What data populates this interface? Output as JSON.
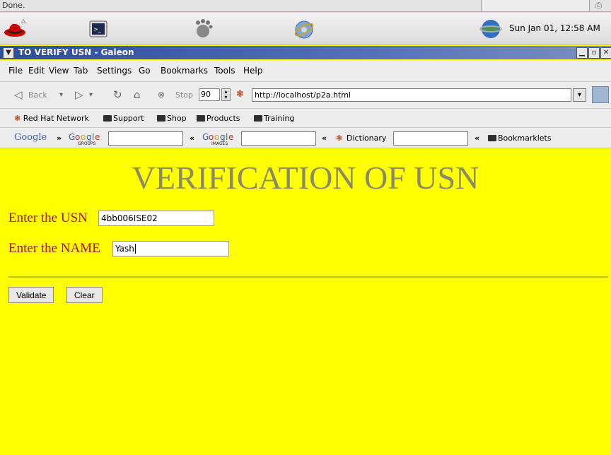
{
  "status": {
    "text": "Done."
  },
  "panel": {
    "clock": "Sun Jan 01, 12:58 AM"
  },
  "window": {
    "title": "TO VERIFY USN - Galeon"
  },
  "menubar": [
    "File",
    "Edit",
    "View",
    "Tab",
    "Settings",
    "Go",
    "Bookmarks",
    "Tools",
    "Help"
  ],
  "navbar": {
    "back": "Back",
    "stop": "Stop",
    "zoom": "90",
    "url": "http://localhost/p2a.html"
  },
  "bookmarks": [
    "Red Hat Network",
    "Support",
    "Shop",
    "Products",
    "Training"
  ],
  "googlebar": {
    "google": "Google",
    "dictionary": "Dictionary",
    "bookmarklets": "Bookmarklets"
  },
  "page": {
    "heading": "VERIFICATION OF USN",
    "usn_label": "Enter the USN",
    "usn_value": "4bb006ISE02",
    "name_label": "Enter the NAME",
    "name_value": "Yash",
    "validate_label": "Validate",
    "clear_label": "Clear"
  },
  "colors": {
    "page_bg": "#ffff00",
    "heading": "#8a8a6a",
    "label": "#b01010",
    "titlebar": "#2a4da0"
  }
}
